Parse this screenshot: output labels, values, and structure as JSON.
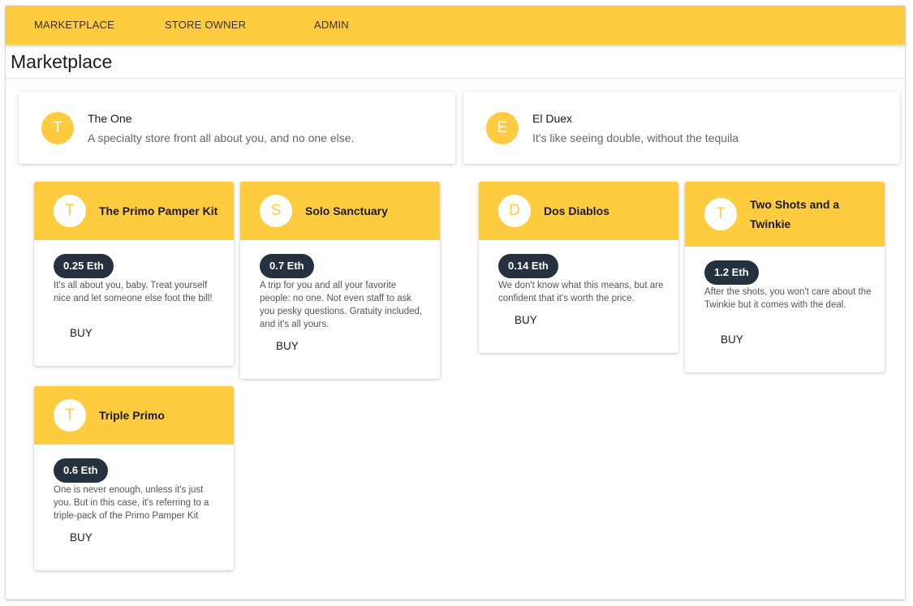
{
  "nav": {
    "items": [
      {
        "label": "MARKETPLACE"
      },
      {
        "label": "STORE OWNER"
      },
      {
        "label": "ADMIN"
      }
    ]
  },
  "page": {
    "title": "Marketplace"
  },
  "stores": [
    {
      "initial": "T",
      "name": "The One",
      "description": "A specialty store front all about you, and no one else.",
      "products": [
        {
          "initial": "T",
          "name": "The Primo Pamper Kit",
          "price": "0.25 Eth",
          "description": "It's all about you, baby. Treat yourself nice and let someone else foot the bill!",
          "buy_label": "BUY"
        },
        {
          "initial": "S",
          "name": "Solo Sanctuary",
          "price": "0.7 Eth",
          "description": "A trip for you and all your favorite people: no one. Not even staff to ask you pesky questions. Gratuity included, and it's all yours.",
          "buy_label": "BUY"
        },
        {
          "initial": "T",
          "name": "Triple Primo",
          "price": "0.6 Eth",
          "description": "One is never enough, unless it's just you. But in this case, it's referring to a triple-pack of the Primo Pamper Kit",
          "buy_label": "BUY"
        }
      ]
    },
    {
      "initial": "E",
      "name": "El Duex",
      "description": "It's like seeing double, without the tequila",
      "products": [
        {
          "initial": "D",
          "name": "Dos Diablos",
          "price": "0.14 Eth",
          "description": "We don't know what this means, but are confident that it's worth the price.",
          "buy_label": "BUY"
        },
        {
          "initial": "T",
          "name": "Two Shots and a Twinkie",
          "price": "1.2 Eth",
          "description": "After the shots, you won't care about the Twinkie but it comes with the deal.",
          "buy_label": "BUY"
        }
      ]
    }
  ],
  "colors": {
    "accent": "#ffcc40",
    "chip": "#263140"
  }
}
